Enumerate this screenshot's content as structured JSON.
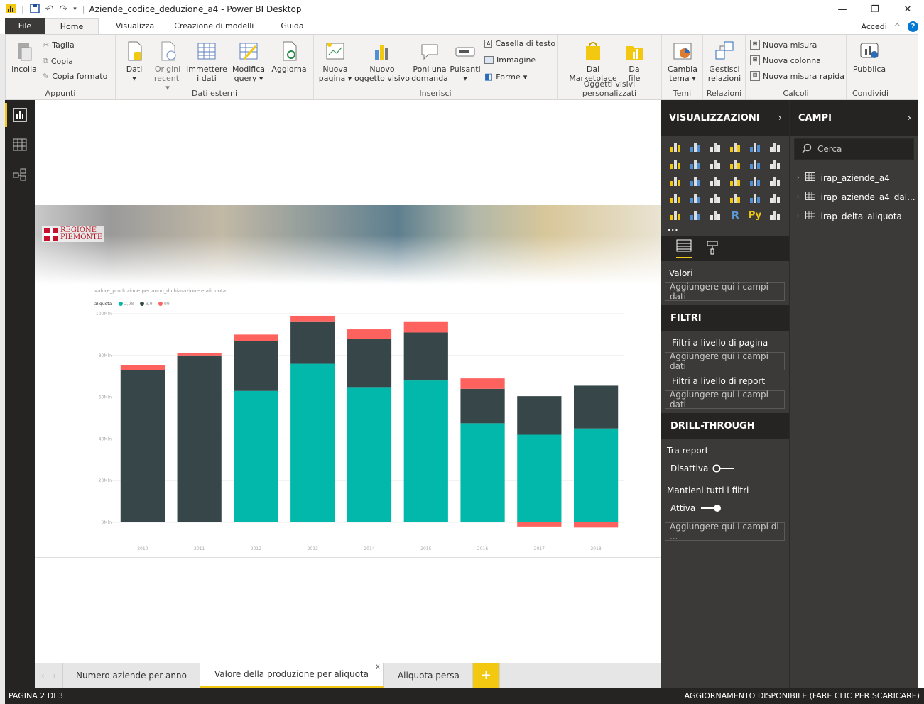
{
  "window": {
    "title": "Aziende_codice_deduzione_a4 - Power BI Desktop"
  },
  "tabs": [
    "File",
    "Home",
    "Visualizza",
    "Creazione di modelli",
    "Guida"
  ],
  "account": {
    "signin": "Accedi"
  },
  "ribbon": {
    "appunti": {
      "label": "Appunti",
      "incolla": "Incolla",
      "taglia": "Taglia",
      "copia": "Copia",
      "copia_formato": "Copia formato"
    },
    "dati_esterni": {
      "label": "Dati esterni",
      "dati": "Dati",
      "origini": "Origini",
      "origini2": "recenti",
      "immettere": "Immettere",
      "immettere2": "i dati",
      "modifica": "Modifica",
      "modifica2": "query",
      "aggiorna": "Aggiorna"
    },
    "inserisci": {
      "label": "Inserisci",
      "nuova_pagina": "Nuova",
      "nuova_pagina2": "pagina",
      "nuovo_oggetto": "Nuovo",
      "nuovo_oggetto2": "oggetto visivo",
      "poni": "Poni una",
      "poni2": "domanda",
      "pulsanti": "Pulsanti",
      "casella": "Casella di testo",
      "immagine": "Immagine",
      "forme": "Forme"
    },
    "oggetti": {
      "label": "Oggetti visivi personalizzati",
      "marketplace": "Dal",
      "marketplace2": "Marketplace",
      "da_file": "Da",
      "da_file2": "file"
    },
    "temi": {
      "label": "Temi",
      "cambia": "Cambia",
      "cambia2": "tema"
    },
    "relazioni": {
      "label": "Relazioni",
      "gestisci": "Gestisci",
      "gestisci2": "relazioni"
    },
    "calcoli": {
      "label": "Calcoli",
      "nuova_misura": "Nuova misura",
      "nuova_colonna": "Nuova colonna",
      "misura_rapida": "Nuova misura rapida"
    },
    "condividi": {
      "label": "Condividi",
      "pubblica": "Pubblica"
    }
  },
  "report": {
    "logo_line1": "REGIONE",
    "logo_line2": "PIEMONTE"
  },
  "chart_data": {
    "type": "bar",
    "stacked": true,
    "title": "valore_produzione per anno_dichiarazione e aliquota",
    "legend_title": "aliquota",
    "legend_position": "top-left",
    "categories": [
      "2010",
      "2011",
      "2012",
      "2013",
      "2014",
      "2015",
      "2016",
      "2017",
      "2018"
    ],
    "series": [
      {
        "name": "2,98",
        "color": "#01b8aa",
        "values": [
          0,
          0,
          63,
          76,
          64.5,
          68,
          47.5,
          42,
          45
        ]
      },
      {
        "name": "3,9",
        "color": "#374649",
        "values": [
          73,
          80,
          24,
          20,
          23.5,
          23,
          16.5,
          18.5,
          20.5
        ]
      },
      {
        "name": "99",
        "color": "#fd625e",
        "values": [
          2.5,
          1,
          3,
          3,
          4.5,
          5,
          5,
          -2,
          -2.5
        ]
      }
    ],
    "ylim": [
      0,
      100
    ],
    "yticks": [
      "100Mln",
      "80Mln",
      "60Mln",
      "40Mln",
      "20Mln",
      "0Mln"
    ],
    "grid": true
  },
  "pages": {
    "tab1": "Numero aziende per anno",
    "tab2": "Valore della produzione per aliquota",
    "tab3": "Aliquota persa",
    "close": "x",
    "add": "+"
  },
  "status": {
    "page": "PAGINA 2 DI 3",
    "update": "AGGIORNAMENTO DISPONIBILE (FARE CLIC PER SCARICARE)"
  },
  "viz_pane": {
    "title": "VISUALIZZAZIONI",
    "more": "...",
    "valori_label": "Valori",
    "drop_placeholder": "Aggiungere qui i campi dati",
    "filtri_title": "FILTRI",
    "filtri_pagina": "Filtri a livello di pagina",
    "filtri_report": "Filtri a livello di report",
    "drill_title": "DRILL-THROUGH",
    "tra_report": "Tra report",
    "disattiva": "Disattiva",
    "mantieni": "Mantieni tutti i filtri",
    "attiva": "Attiva",
    "drill_placeholder": "Aggiungere qui i campi di ..."
  },
  "fields_pane": {
    "title": "CAMPI",
    "search_placeholder": "Cerca",
    "tables": [
      "irap_aziende_a4",
      "irap_aziende_a4_dal...",
      "irap_delta_aliquota"
    ]
  }
}
